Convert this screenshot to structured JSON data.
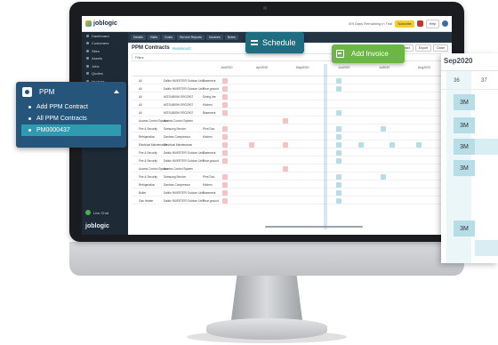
{
  "app": {
    "logo_top": "joblogic",
    "logo_bottom": "joblogic",
    "days_remaining": "8/9 Days Remaining in Trial",
    "subscribe": "Subscribe",
    "help": "Help"
  },
  "sidebar": {
    "items": [
      "Dashboard",
      "Customers",
      "Sites",
      "Assets",
      "Jobs",
      "Quotes",
      "Invoices",
      "PPM",
      "Purchase Orders",
      "Engineers",
      "Suppliers",
      "Reports",
      "Settings"
    ],
    "lower_items": [
      "Settings",
      "Help & Resources"
    ],
    "live_chat": "Live Chat"
  },
  "toolbar": {
    "buttons": [
      "Details",
      "Visits",
      "Costs",
      "Service Reports",
      "Invoices",
      "Notes"
    ]
  },
  "page": {
    "title": "PPM Contracts",
    "code": "PM0000437",
    "buttons": [
      "Extend Contract",
      "Export",
      "Close"
    ],
    "filter": "Filters"
  },
  "grid": {
    "months": [
      "Jan2020",
      "Apr2020",
      "May2020",
      "Jun2020",
      "Jul2020",
      "Aug2020"
    ],
    "rows": [
      {
        "name": "All",
        "asset": "Dalkin INVERTER Outdoor Unit",
        "loc": "Basement"
      },
      {
        "name": "All",
        "asset": "Dalkin INVERTER Outdoor Unit",
        "loc": "Rear ground"
      },
      {
        "name": "All",
        "asset": "MITSUBISHI ERO2907",
        "loc": "Dining Are"
      },
      {
        "name": "All",
        "asset": "MITSUBISHI ERO2907",
        "loc": "Kitchen"
      },
      {
        "name": "All",
        "asset": "MITSUBISHI ERO2907",
        "loc": "Basement"
      },
      {
        "name": "Access Control System",
        "asset": "Access Control System",
        "loc": ""
      },
      {
        "name": "Fire & Security",
        "asset": "Samsung Service",
        "loc": "Print Dou"
      },
      {
        "name": "Refrigeration",
        "asset": "Danfoss Compressor",
        "loc": "Kitchen"
      },
      {
        "name": "Electrical Maintenance",
        "asset": "Electrical Maintenance",
        "loc": ""
      },
      {
        "name": "Fire & Security",
        "asset": "Dalkin INVERTER Outdoor Unit",
        "loc": "Basement"
      },
      {
        "name": "Fire & Security",
        "asset": "Dalkin INVERTER Outdoor Unit",
        "loc": "Rear ground"
      },
      {
        "name": "Access Control System",
        "asset": "Access Control System",
        "loc": ""
      },
      {
        "name": "Fire & Security",
        "asset": "Samsung Service",
        "loc": "Print Dou"
      },
      {
        "name": "Refrigeration",
        "asset": "Danfoss Compressor",
        "loc": "Kitchen"
      },
      {
        "name": "Boiler",
        "asset": "Dalkin INVERTER Outdoor Unit",
        "loc": "Basement"
      },
      {
        "name": "Gas Heater",
        "asset": "Dalkin INVERTER Outdoor Unit",
        "loc": "Rear ground"
      }
    ]
  },
  "schedule_badge": {
    "label": "Schedule"
  },
  "invoice_badge": {
    "label": "Add Invoice"
  },
  "ppm_menu": {
    "title": "PPM",
    "items": [
      "Add PPM Contract",
      "All PPM Contracts",
      "PM0000437"
    ]
  },
  "calendar": {
    "month": "Sep2020",
    "day_a": "36",
    "day_b": "37",
    "slots": [
      "3M",
      "3M",
      "3M",
      "3M",
      "3M"
    ]
  },
  "colors": {
    "schedule": "#1f6d80",
    "invoice": "#6bb644",
    "ppm_panel": "#25557a",
    "ppm_selected": "#2e9bb0",
    "slot": "#b7dde6"
  }
}
